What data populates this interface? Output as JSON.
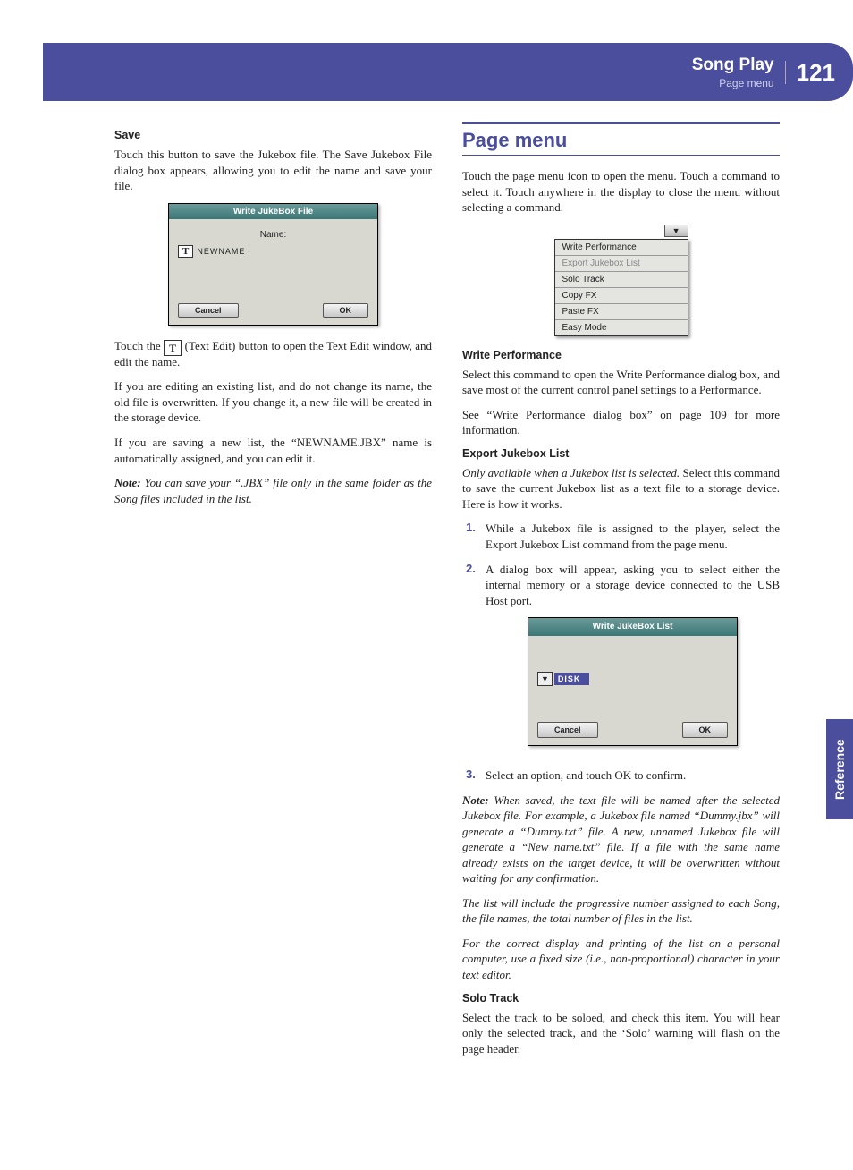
{
  "header": {
    "title": "Song Play",
    "subtitle": "Page menu",
    "page_number": "121"
  },
  "side_tab": "Reference",
  "left_col": {
    "save_heading": "Save",
    "save_intro": "Touch this button to save the Jukebox file. The Save Jukebox File dialog box appears, allowing you to edit the name and save your file.",
    "dialog": {
      "title": "Write JukeBox File",
      "name_label": "Name:",
      "name_value": "NEWNAME",
      "cancel": "Cancel",
      "ok": "OK"
    },
    "touch_t_pre": "Touch the ",
    "touch_t_post": " (Text Edit) button to open the Text Edit window, and edit the name.",
    "editing_para": "If you are editing an existing list, and do not change its name, the old file is overwritten. If you change it, a new file will be created in the storage device.",
    "newlist_para": "If you are saving a new list, the “NEWNAME.JBX” name is automatically assigned, and you can edit it.",
    "note_label": "Note:",
    "note_text": " You can save your “.JBX” file only in the same folder as the Song files included in the list."
  },
  "right_col": {
    "section_title": "Page menu",
    "intro": "Touch the page menu icon to open the menu. Touch a command to select it. Touch anywhere in the display to close the menu without selecting a command.",
    "menu_items": [
      "Write Performance",
      "Export Jukebox List",
      "Solo Track",
      "Copy FX",
      "Paste FX",
      "Easy Mode"
    ],
    "write_perf": {
      "heading": "Write Performance",
      "p1": "Select this command to open the Write Performance dialog box, and save most of the current control panel settings to a Performance.",
      "p2": "See “Write Performance dialog box” on page 109 for more information."
    },
    "export": {
      "heading": "Export Jukebox List",
      "intro_italic": "Only available when a Jukebox list is selected.",
      "intro_rest": " Select this command to save the current Jukebox list as a text file to a storage device. Here is how it works.",
      "step1": "While a Jukebox file is assigned to the player, select the Export Jukebox List command from the page menu.",
      "step2": "A dialog box will appear, asking you to select either the internal memory or a storage device connected to the USB Host port.",
      "dialog": {
        "title": "Write JukeBox List",
        "disk": "DISK",
        "cancel": "Cancel",
        "ok": "OK"
      },
      "step3": "Select an option, and touch OK to confirm.",
      "note_label": "Note:",
      "note1": " When saved, the text file will be named after the selected Jukebox file. For example, a Jukebox file named “Dummy.jbx” will generate a “Dummy.txt” file. A new, unnamed Jukebox file will generate a “New_name.txt” file. If a file with the same name already exists on the target device, it will be overwritten without waiting for any confirmation.",
      "note2": "The list will include the progressive number assigned to each Song, the file names, the total number of files in the list.",
      "note3": "For the correct display and printing of the list on a personal computer, use a fixed size (i.e., non-proportional) character in your text editor."
    },
    "solo": {
      "heading": "Solo Track",
      "p1": "Select the track to be soloed, and check this item. You will hear only the selected track, and the ‘Solo’ warning will flash on the page header."
    }
  }
}
